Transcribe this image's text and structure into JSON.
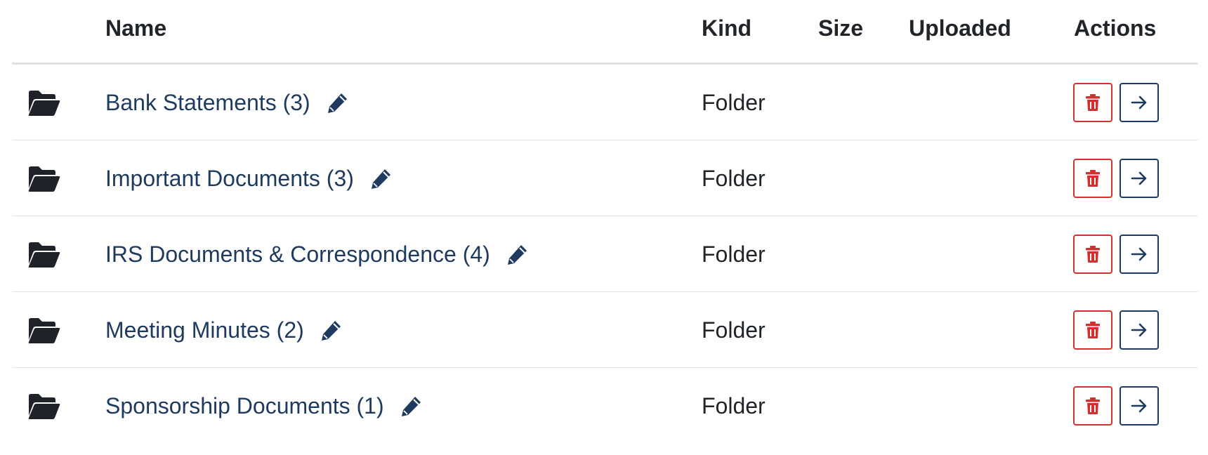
{
  "colors": {
    "link": "#1f3a5f",
    "danger": "#d32f2f",
    "icon_dark": "#1f2329",
    "border": "#dee2e6"
  },
  "table": {
    "headers": {
      "icon": "",
      "name": "Name",
      "kind": "Kind",
      "size": "Size",
      "uploaded": "Uploaded",
      "actions": "Actions"
    },
    "rows": [
      {
        "icon": "folder-open-icon",
        "name": "Bank Statements (3)",
        "kind": "Folder",
        "size": "",
        "uploaded": ""
      },
      {
        "icon": "folder-open-icon",
        "name": "Important Documents (3)",
        "kind": "Folder",
        "size": "",
        "uploaded": ""
      },
      {
        "icon": "folder-open-icon",
        "name": "IRS Documents & Correspondence (4)",
        "kind": "Folder",
        "size": "",
        "uploaded": ""
      },
      {
        "icon": "folder-open-icon",
        "name": "Meeting Minutes (2)",
        "kind": "Folder",
        "size": "",
        "uploaded": ""
      },
      {
        "icon": "folder-open-icon",
        "name": "Sponsorship Documents (1)",
        "kind": "Folder",
        "size": "",
        "uploaded": ""
      }
    ],
    "row_actions": {
      "edit_icon": "pencil-icon",
      "delete_icon": "trash-icon",
      "open_icon": "arrow-right-icon"
    }
  }
}
